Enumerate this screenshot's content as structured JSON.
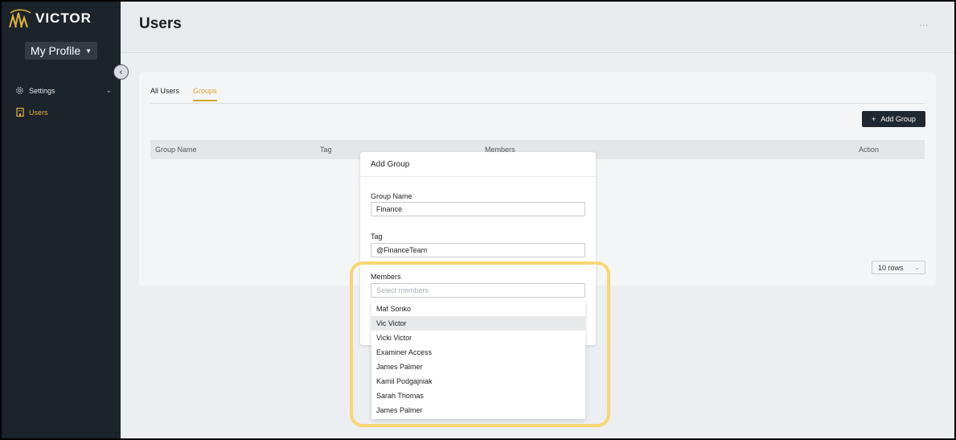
{
  "app": {
    "brand": "VICTOR",
    "accent": "#e0b43a"
  },
  "sidebar": {
    "profile_label": "My Profile",
    "items": [
      {
        "label": "Settings",
        "icon": "gear-icon"
      },
      {
        "label": "Users",
        "icon": "building-icon"
      }
    ]
  },
  "header": {
    "title": "Users",
    "dots": "..."
  },
  "tabs": [
    {
      "label": "All Users"
    },
    {
      "label": "Groups"
    }
  ],
  "toolbar": {
    "add_group_label": "Add Group"
  },
  "table": {
    "columns": [
      "Group Name",
      "Tag",
      "Members",
      "Action"
    ]
  },
  "pagination": {
    "rows_label": "10 rows"
  },
  "modal": {
    "title": "Add Group",
    "group_name_label": "Group Name",
    "group_name_value": "Finance",
    "tag_label": "Tag",
    "tag_value": "@FinanceTeam",
    "members_label": "Members",
    "members_placeholder": "Select members"
  },
  "members_options": [
    "Maf Sonko",
    "Vic Victor",
    "Vicki Victor",
    "Examiner Access",
    "James Palmer",
    "Kamil Podgajniak",
    "Sarah Thomas",
    "James Palmer"
  ]
}
